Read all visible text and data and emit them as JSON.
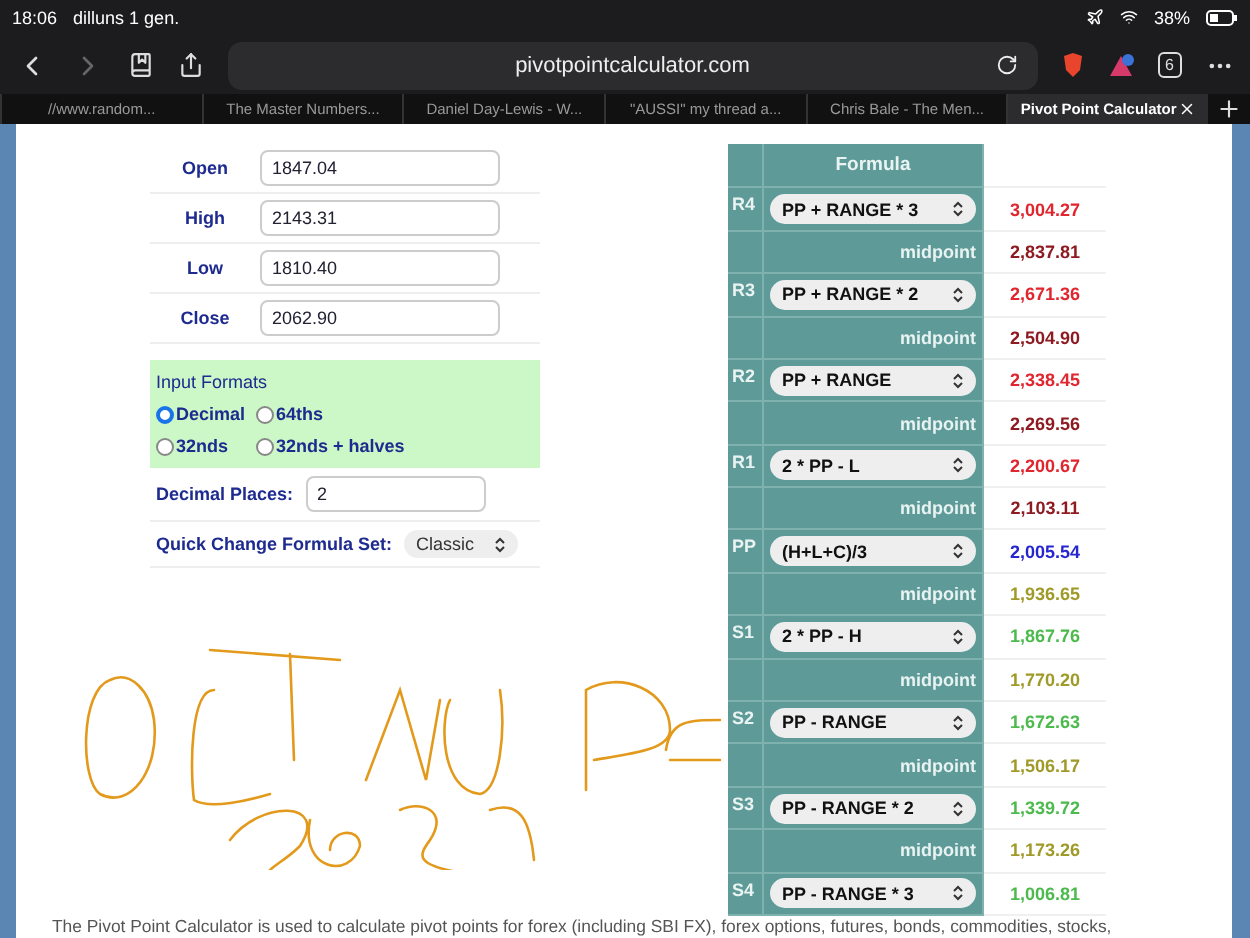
{
  "status_bar": {
    "time": "18:06",
    "date": "dilluns 1 gen.",
    "battery": "38%"
  },
  "toolbar": {
    "url": "pivotpointcalculator.com",
    "tab_count": "6"
  },
  "tabs": [
    {
      "label": "//www.random...",
      "selected": false
    },
    {
      "label": "The Master Numbers...",
      "selected": false
    },
    {
      "label": "Daniel Day-Lewis - W...",
      "selected": false
    },
    {
      "label": "\"AUSSI\" my thread a...",
      "selected": false
    },
    {
      "label": "Chris Bale - The Men...",
      "selected": false
    },
    {
      "label": "Pivot Point Calculator",
      "selected": true
    }
  ],
  "inputs": [
    {
      "label": "Open",
      "value": "1847.04"
    },
    {
      "label": "High",
      "value": "2143.31"
    },
    {
      "label": "Low",
      "value": "1810.40"
    },
    {
      "label": "Close",
      "value": "2062.90"
    }
  ],
  "input_formats": {
    "title": "Input Formats",
    "options": [
      {
        "label": "Decimal",
        "selected": true
      },
      {
        "label": "64ths",
        "selected": false
      },
      {
        "label": "32nds",
        "selected": false
      },
      {
        "label": "32nds + halves",
        "selected": false
      }
    ]
  },
  "decimal_places": {
    "label": "Decimal Places:",
    "value": "2"
  },
  "formula_set": {
    "label": "Quick Change Formula Set:",
    "value": "Classic"
  },
  "table": {
    "header": "Formula",
    "rows": [
      {
        "kind": "level",
        "label": "R4",
        "formula": "PP + RANGE * 3",
        "value": "3,004.27",
        "color": "#e0262e"
      },
      {
        "kind": "midpoint",
        "label": "midpoint",
        "value": "2,837.81",
        "color": "#8e1b22"
      },
      {
        "kind": "level",
        "label": "R3",
        "formula": "PP + RANGE * 2",
        "value": "2,671.36",
        "color": "#e0262e"
      },
      {
        "kind": "midpoint",
        "label": "midpoint",
        "value": "2,504.90",
        "color": "#8e1b22"
      },
      {
        "kind": "level",
        "label": "R2",
        "formula": "PP + RANGE",
        "value": "2,338.45",
        "color": "#e0262e"
      },
      {
        "kind": "midpoint",
        "label": "midpoint",
        "value": "2,269.56",
        "color": "#8e1b22"
      },
      {
        "kind": "level",
        "label": "R1",
        "formula": "2 * PP - L",
        "value": "2,200.67",
        "color": "#e0262e"
      },
      {
        "kind": "midpoint",
        "label": "midpoint",
        "value": "2,103.11",
        "color": "#8e1b22"
      },
      {
        "kind": "level",
        "label": "PP",
        "formula": "(H+L+C)/3",
        "value": "2,005.54",
        "color": "#2626d0"
      },
      {
        "kind": "midpoint",
        "label": "midpoint",
        "value": "1,936.65",
        "color": "#a09a28"
      },
      {
        "kind": "level",
        "label": "S1",
        "formula": "2 * PP - H",
        "value": "1,867.76",
        "color": "#4cba4c"
      },
      {
        "kind": "midpoint",
        "label": "midpoint",
        "value": "1,770.20",
        "color": "#a09a28"
      },
      {
        "kind": "level",
        "label": "S2",
        "formula": "PP - RANGE",
        "value": "1,672.63",
        "color": "#4cba4c"
      },
      {
        "kind": "midpoint",
        "label": "midpoint",
        "value": "1,506.17",
        "color": "#a09a28"
      },
      {
        "kind": "level",
        "label": "S3",
        "formula": "PP - RANGE * 2",
        "value": "1,339.72",
        "color": "#4cba4c"
      },
      {
        "kind": "midpoint",
        "label": "midpoint",
        "value": "1,173.26",
        "color": "#a09a28"
      },
      {
        "kind": "level",
        "label": "S4",
        "formula": "PP - RANGE * 3",
        "value": "1,006.81",
        "color": "#4cba4c"
      }
    ]
  },
  "description": "The Pivot Point Calculator is used to calculate pivot points for forex (including SBI FX), forex options, futures, bonds, commodities, stocks,"
}
